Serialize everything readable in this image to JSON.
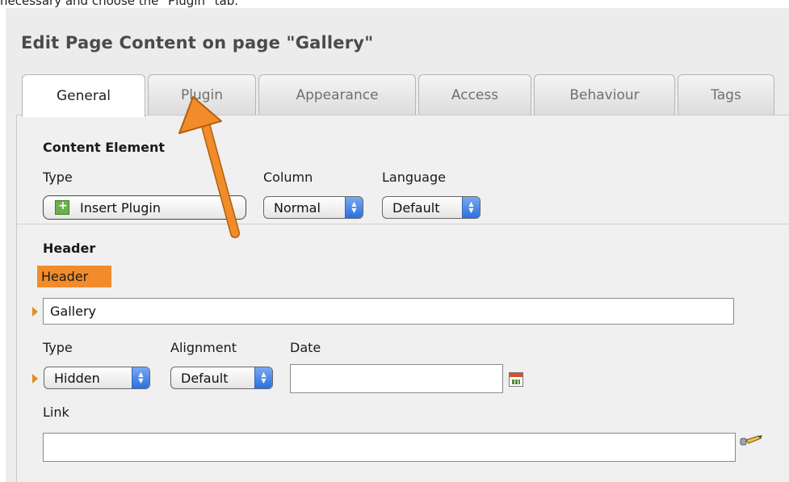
{
  "caption": "necessary and choose the \"Plugin\" tab.",
  "page_title": "Edit Page Content on page \"Gallery\"",
  "tabs": [
    {
      "label": "General",
      "active": true
    },
    {
      "label": "Plugin",
      "active": false
    },
    {
      "label": "Appearance",
      "active": false
    },
    {
      "label": "Access",
      "active": false
    },
    {
      "label": "Behaviour",
      "active": false
    },
    {
      "label": "Tags",
      "active": false
    }
  ],
  "content_element": {
    "heading": "Content Element",
    "type_label": "Type",
    "type_value": "Insert Plugin",
    "column_label": "Column",
    "column_value": "Normal",
    "language_label": "Language",
    "language_value": "Default"
  },
  "header_section": {
    "heading": "Header",
    "field_tag": "Header",
    "header_value": "Gallery",
    "type_label": "Type",
    "type_value": "Hidden",
    "alignment_label": "Alignment",
    "alignment_value": "Default",
    "date_label": "Date",
    "date_value": "",
    "link_label": "Link",
    "link_value": ""
  },
  "colors": {
    "annotation_arrow": "#f28b2a",
    "header_tag": "#f28b2a",
    "select_arrow": "#2c6fe0"
  },
  "icons": {
    "plugin": "plugin-icon",
    "calendar": "calendar-icon",
    "link_wizard": "pencil-wizard-icon",
    "field_marker": "triangle-marker-icon"
  }
}
